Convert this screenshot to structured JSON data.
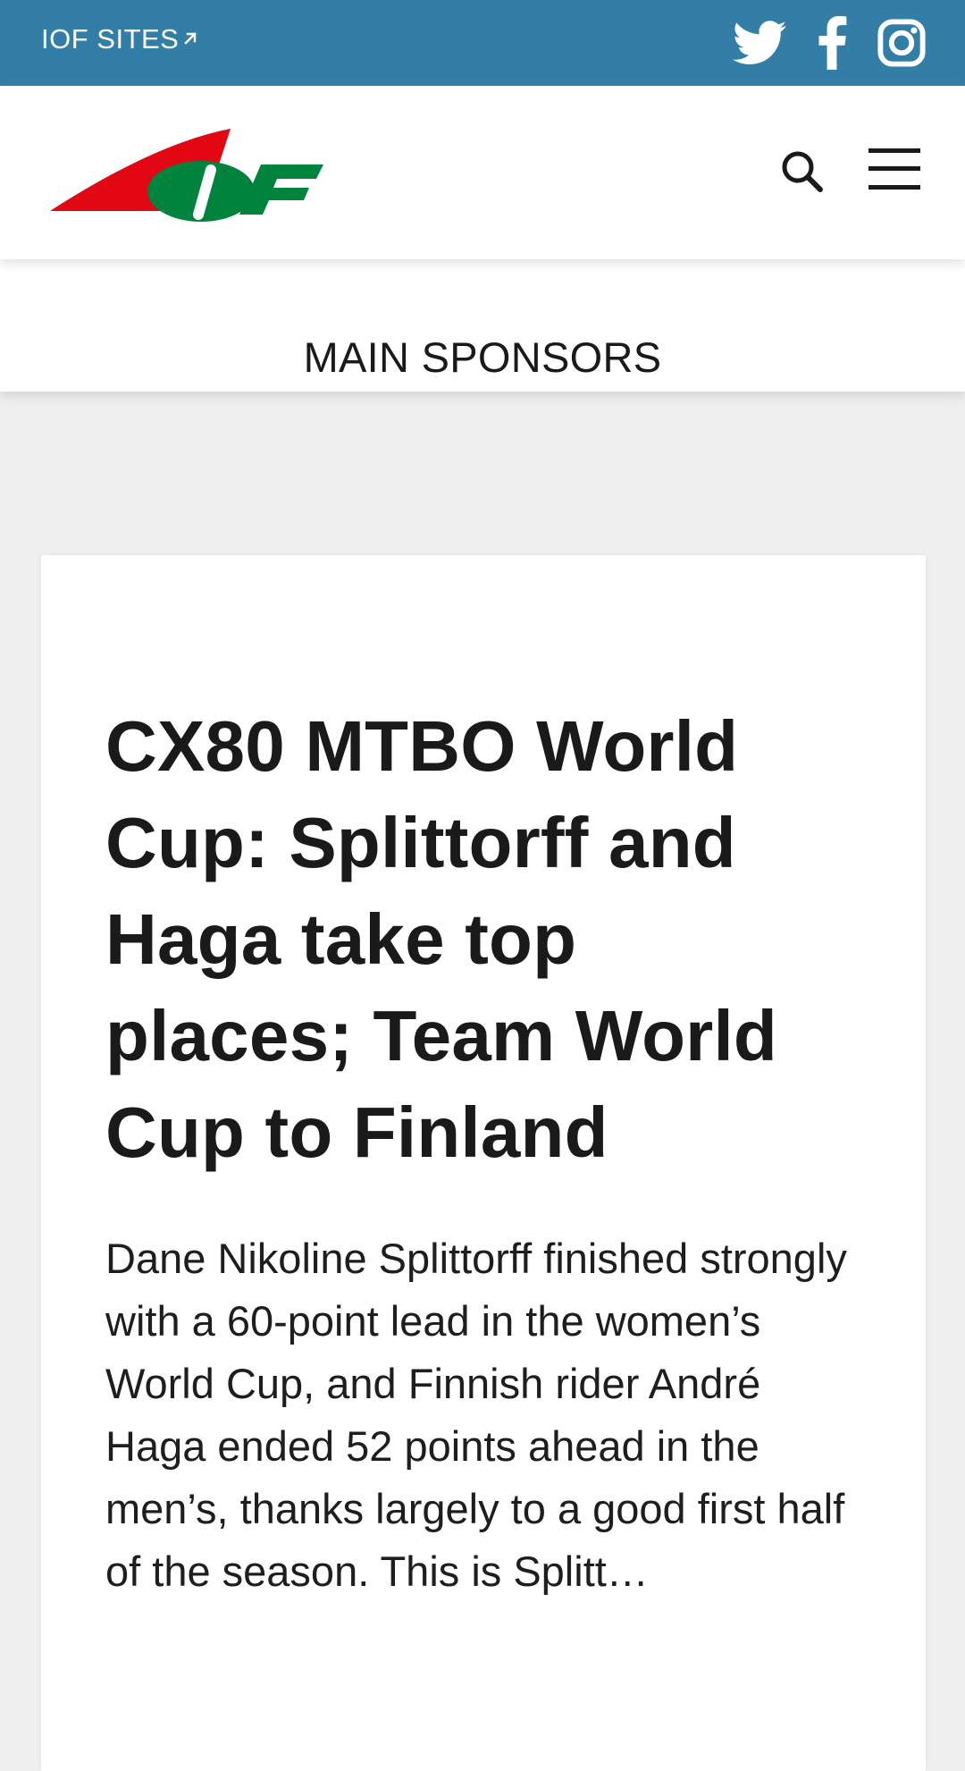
{
  "topbar": {
    "sites_label": "IOF SITES",
    "social": [
      {
        "icon": "twitter-icon"
      },
      {
        "icon": "facebook-icon"
      },
      {
        "icon": "instagram-icon"
      }
    ]
  },
  "header": {
    "logo_text": "IOF",
    "search_icon": "search-icon",
    "menu_icon": "hamburger-menu-icon"
  },
  "sponsors": {
    "title": "MAIN SPONSORS"
  },
  "article": {
    "title": "CX80 MTBO World Cup: Splittorff and Haga take top places; Team World Cup to Finland",
    "excerpt": "Dane Nikoline Splittorff finished strongly with a 60-point lead in the women’s World Cup, and Finnish rider André Haga ended 52 points ahead in the men’s, thanks largely to a good first half of the season. This is Splitt…"
  },
  "colors": {
    "topbar": "#327ea7",
    "logo_red": "#e30613",
    "logo_green": "#00843d",
    "background": "#efefef"
  }
}
